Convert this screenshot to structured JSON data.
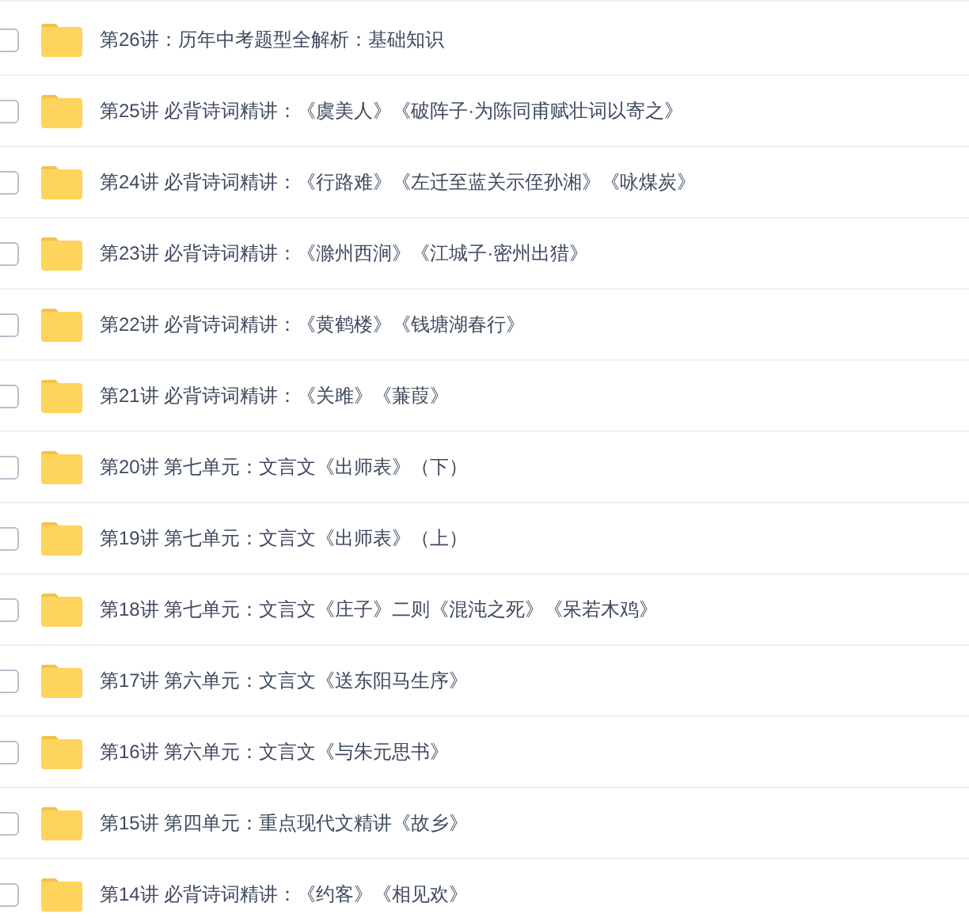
{
  "files": [
    {
      "name": "第26讲：历年中考题型全解析：基础知识",
      "checked": false
    },
    {
      "name": "第25讲 必背诗词精讲：《虞美人》《破阵子·为陈同甫赋壮词以寄之》",
      "checked": false
    },
    {
      "name": "第24讲 必背诗词精讲：《行路难》《左迁至蓝关示侄孙湘》《咏煤炭》",
      "checked": false
    },
    {
      "name": "第23讲 必背诗词精讲：《滁州西涧》《江城子·密州出猎》",
      "checked": false
    },
    {
      "name": "第22讲 必背诗词精讲：《黄鹤楼》《钱塘湖春行》",
      "checked": false
    },
    {
      "name": "第21讲 必背诗词精讲：《关雎》《蒹葭》",
      "checked": false
    },
    {
      "name": "第20讲 第七单元：文言文《出师表》（下）",
      "checked": false
    },
    {
      "name": "第19讲 第七单元：文言文《出师表》（上）",
      "checked": false
    },
    {
      "name": "第18讲 第七单元：文言文《庄子》二则《混沌之死》《呆若木鸡》",
      "checked": false
    },
    {
      "name": "第17讲 第六单元：文言文《送东阳马生序》",
      "checked": false
    },
    {
      "name": "第16讲 第六单元：文言文《与朱元思书》",
      "checked": false
    },
    {
      "name": "第15讲 第四单元：重点现代文精讲《故乡》",
      "checked": false
    },
    {
      "name": "第14讲 必背诗词精讲：《约客》《相见欢》",
      "checked": false
    }
  ]
}
